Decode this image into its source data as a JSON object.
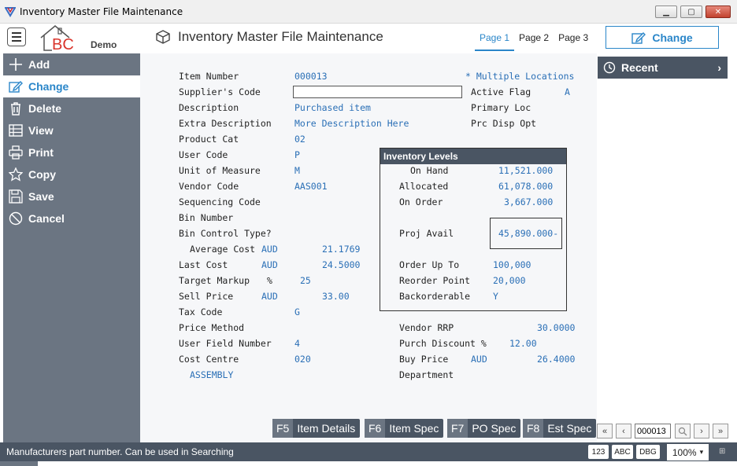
{
  "window": {
    "title": "Inventory Master File Maintenance"
  },
  "header": {
    "logo_letters": "BC",
    "logo_sub": "Demo",
    "page_title": "Inventory Master File Maintenance",
    "tabs": [
      {
        "label": "Page 1",
        "active": true
      },
      {
        "label": "Page 2",
        "active": false
      },
      {
        "label": "Page 3",
        "active": false
      }
    ],
    "change_label": "Change"
  },
  "sidebar": {
    "items": [
      {
        "label": "Add",
        "icon": "plus-icon",
        "active": false
      },
      {
        "label": "Change",
        "icon": "edit-icon",
        "active": true
      },
      {
        "label": "Delete",
        "icon": "trash-icon",
        "active": false
      },
      {
        "label": "View",
        "icon": "table-icon",
        "active": false
      },
      {
        "label": "Print",
        "icon": "printer-icon",
        "active": false
      },
      {
        "label": "Copy",
        "icon": "star-icon",
        "active": false
      },
      {
        "label": "Save",
        "icon": "save-icon",
        "active": false
      },
      {
        "label": "Cancel",
        "icon": "cancel-icon",
        "active": false
      }
    ]
  },
  "form": {
    "item_number": {
      "label": "Item Number",
      "value": "000013"
    },
    "multiple_locations": "* Multiple Locations",
    "suppliers_code": {
      "label": "Supplier's Code",
      "value": ""
    },
    "active_flag": {
      "label": "Active Flag",
      "value": "A"
    },
    "description": {
      "label": "Description",
      "value": "Purchased item"
    },
    "primary_loc": {
      "label": "Primary Loc"
    },
    "extra_description": {
      "label": "Extra Description",
      "value": "More Description Here"
    },
    "prc_disp_opt": {
      "label": "Prc Disp Opt"
    },
    "product_cat": {
      "label": "Product Cat",
      "value": "02"
    },
    "user_code": {
      "label": "User Code",
      "value": "P"
    },
    "unit_of_measure": {
      "label": "Unit of Measure",
      "value": "M"
    },
    "vendor_code": {
      "label": "Vendor Code",
      "value": "AAS001"
    },
    "sequencing_code": {
      "label": "Sequencing Code"
    },
    "bin_number": {
      "label": "Bin Number"
    },
    "bin_control_type": {
      "label": "Bin Control Type?"
    },
    "average_cost": {
      "label": "Average Cost",
      "currency": "AUD",
      "value": "21.1769"
    },
    "last_cost": {
      "label": "Last Cost",
      "currency": "AUD",
      "value": "24.5000"
    },
    "target_markup": {
      "label": "Target Markup",
      "unit": "%",
      "value": "25"
    },
    "sell_price": {
      "label": "Sell Price",
      "currency": "AUD",
      "value": "33.00"
    },
    "tax_code": {
      "label": "Tax Code",
      "value": "G"
    },
    "price_method": {
      "label": "Price Method"
    },
    "user_field_number": {
      "label": "User Field Number",
      "value": "4"
    },
    "cost_centre": {
      "label": "Cost Centre",
      "value": "020",
      "description": "ASSEMBLY"
    },
    "vendor_rrp": {
      "label": "Vendor RRP",
      "value": "30.0000"
    },
    "purch_discount": {
      "label": "Purch Discount %",
      "value": "12.00"
    },
    "buy_price": {
      "label": "Buy Price",
      "currency": "AUD",
      "value": "26.4000"
    },
    "department": {
      "label": "Department"
    }
  },
  "inventory_levels": {
    "title": "Inventory Levels",
    "on_hand": {
      "label": "On Hand",
      "value": "11,521.000"
    },
    "allocated": {
      "label": "Allocated",
      "value": "61,078.000"
    },
    "on_order": {
      "label": "On Order",
      "value": "3,667.000"
    },
    "proj_avail": {
      "label": "Proj Avail",
      "value": "45,890.000-"
    },
    "order_up_to": {
      "label": "Order Up To",
      "value": "100,000"
    },
    "reorder_point": {
      "label": "Reorder Point",
      "value": "20,000"
    },
    "backorderable": {
      "label": "Backorderable",
      "value": "Y"
    }
  },
  "recent": {
    "label": "Recent"
  },
  "fkeys": [
    {
      "key": "F5",
      "label": "Item Details"
    },
    {
      "key": "F6",
      "label": "Item Spec"
    },
    {
      "key": "F7",
      "label": "PO Spec"
    },
    {
      "key": "F8",
      "label": "Est Spec"
    }
  ],
  "navigation": {
    "record_value": "000013"
  },
  "statusbar": {
    "message": "Manufacturers part number. Can be used in Searching",
    "btn_123": "123",
    "btn_abc": "ABC",
    "btn_dbg": "DBG",
    "zoom": "100%"
  },
  "colors": {
    "accent": "#2a86c9",
    "sidebar": "#6b7582",
    "dark": "#4a5563",
    "value_text": "#2a6fb6"
  }
}
